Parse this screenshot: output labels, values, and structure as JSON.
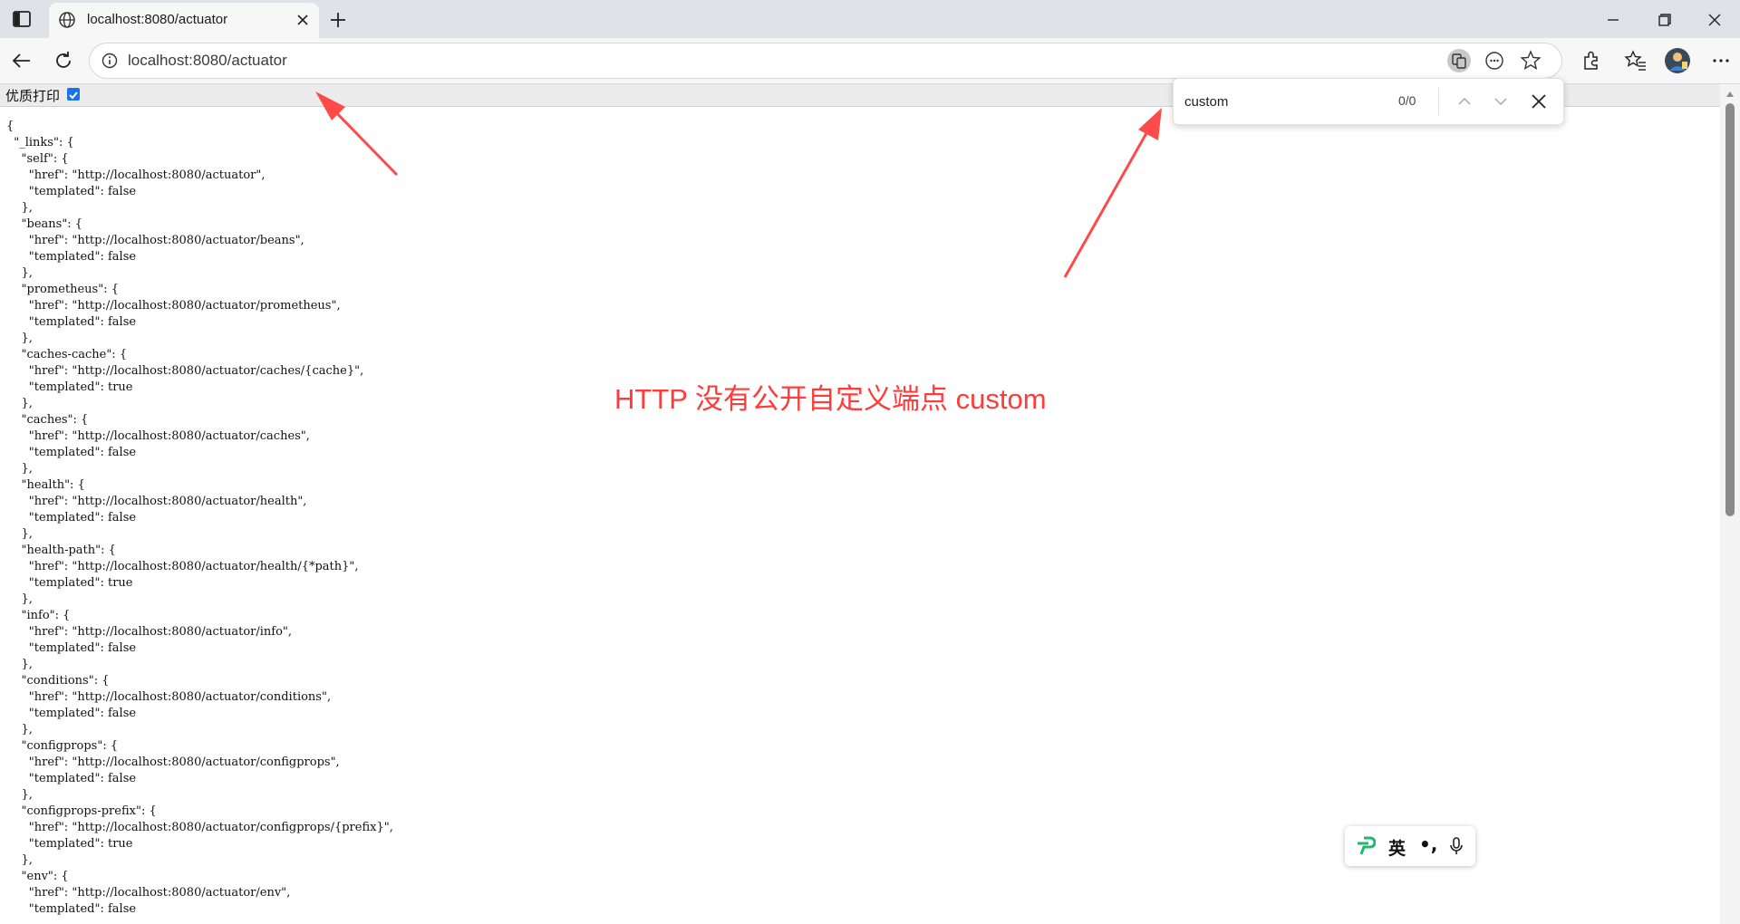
{
  "browser": {
    "tab": {
      "title": "localhost:8080/actuator"
    },
    "address_bar": {
      "url": "localhost:8080/actuator"
    }
  },
  "print_option": {
    "label": "优质打印",
    "checked": true
  },
  "find_bar": {
    "query": "custom",
    "count": "0/0"
  },
  "annotation": {
    "text": "HTTP 没有公开自定义端点 custom",
    "color": "#ff3b3b"
  },
  "ime_toolbar": {
    "language": "英",
    "punctuation": "•,",
    "logo_color": "#1fb870"
  },
  "json_lines": [
    "{",
    "  \"_links\": {",
    "    \"self\": {",
    "      \"href\": \"http://localhost:8080/actuator\",",
    "      \"templated\": false",
    "    },",
    "    \"beans\": {",
    "      \"href\": \"http://localhost:8080/actuator/beans\",",
    "      \"templated\": false",
    "    },",
    "    \"prometheus\": {",
    "      \"href\": \"http://localhost:8080/actuator/prometheus\",",
    "      \"templated\": false",
    "    },",
    "    \"caches-cache\": {",
    "      \"href\": \"http://localhost:8080/actuator/caches/{cache}\",",
    "      \"templated\": true",
    "    },",
    "    \"caches\": {",
    "      \"href\": \"http://localhost:8080/actuator/caches\",",
    "      \"templated\": false",
    "    },",
    "    \"health\": {",
    "      \"href\": \"http://localhost:8080/actuator/health\",",
    "      \"templated\": false",
    "    },",
    "    \"health-path\": {",
    "      \"href\": \"http://localhost:8080/actuator/health/{*path}\",",
    "      \"templated\": true",
    "    },",
    "    \"info\": {",
    "      \"href\": \"http://localhost:8080/actuator/info\",",
    "      \"templated\": false",
    "    },",
    "    \"conditions\": {",
    "      \"href\": \"http://localhost:8080/actuator/conditions\",",
    "      \"templated\": false",
    "    },",
    "    \"configprops\": {",
    "      \"href\": \"http://localhost:8080/actuator/configprops\",",
    "      \"templated\": false",
    "    },",
    "    \"configprops-prefix\": {",
    "      \"href\": \"http://localhost:8080/actuator/configprops/{prefix}\",",
    "      \"templated\": true",
    "    },",
    "    \"env\": {",
    "      \"href\": \"http://localhost:8080/actuator/env\",",
    "      \"templated\": false"
  ]
}
